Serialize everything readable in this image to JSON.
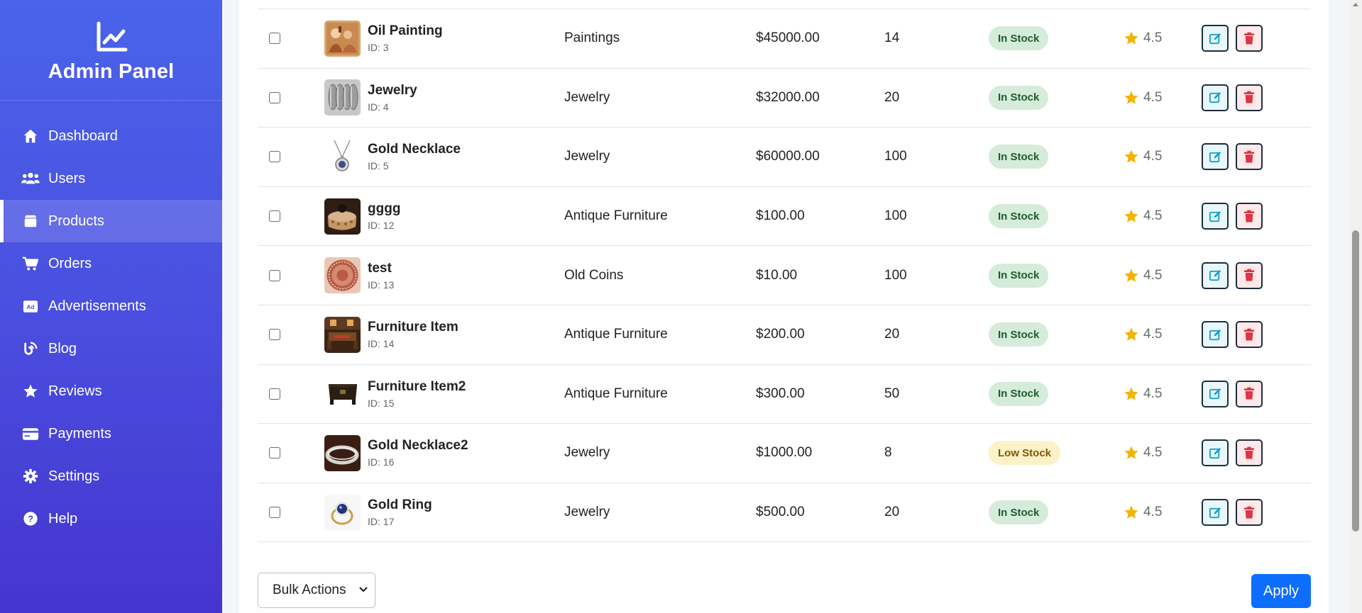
{
  "sidebar": {
    "title": "Admin Panel",
    "logo_icon": "chart-line-icon",
    "items": [
      {
        "label": "Dashboard",
        "icon": "home-icon",
        "active": false
      },
      {
        "label": "Users",
        "icon": "users-icon",
        "active": false
      },
      {
        "label": "Products",
        "icon": "box-icon",
        "active": true
      },
      {
        "label": "Orders",
        "icon": "cart-icon",
        "active": false
      },
      {
        "label": "Advertisements",
        "icon": "ad-icon",
        "active": false
      },
      {
        "label": "Blog",
        "icon": "blog-icon",
        "active": false
      },
      {
        "label": "Reviews",
        "icon": "star-icon",
        "active": false
      },
      {
        "label": "Payments",
        "icon": "credit-card-icon",
        "active": false
      },
      {
        "label": "Settings",
        "icon": "gear-icon",
        "active": false
      },
      {
        "label": "Help",
        "icon": "help-icon",
        "active": false
      }
    ]
  },
  "products": [
    {
      "name": "Oil Painting",
      "id": "ID: 3",
      "category": "Paintings",
      "price": "$45000.00",
      "qty": "14",
      "status": "In Stock",
      "status_type": "ok",
      "rating": "4.5",
      "thumb": "painting"
    },
    {
      "name": "Jewelry",
      "id": "ID: 4",
      "category": "Jewelry",
      "price": "$32000.00",
      "qty": "20",
      "status": "In Stock",
      "status_type": "ok",
      "rating": "4.5",
      "thumb": "rings"
    },
    {
      "name": "Gold Necklace",
      "id": "ID: 5",
      "category": "Jewelry",
      "price": "$60000.00",
      "qty": "100",
      "status": "In Stock",
      "status_type": "ok",
      "rating": "4.5",
      "thumb": "necklace"
    },
    {
      "name": "gggg",
      "id": "ID: 12",
      "category": "Antique Furniture",
      "price": "$100.00",
      "qty": "100",
      "status": "In Stock",
      "status_type": "ok",
      "rating": "4.5",
      "thumb": "box"
    },
    {
      "name": "test",
      "id": "ID: 13",
      "category": "Old Coins",
      "price": "$10.00",
      "qty": "100",
      "status": "In Stock",
      "status_type": "ok",
      "rating": "4.5",
      "thumb": "plate"
    },
    {
      "name": "Furniture Item",
      "id": "ID: 14",
      "category": "Antique Furniture",
      "price": "$200.00",
      "qty": "20",
      "status": "In Stock",
      "status_type": "ok",
      "rating": "4.5",
      "thumb": "room"
    },
    {
      "name": "Furniture Item2",
      "id": "ID: 15",
      "category": "Antique Furniture",
      "price": "$300.00",
      "qty": "50",
      "status": "In Stock",
      "status_type": "ok",
      "rating": "4.5",
      "thumb": "chest"
    },
    {
      "name": "Gold Necklace2",
      "id": "ID: 16",
      "category": "Jewelry",
      "price": "$1000.00",
      "qty": "8",
      "status": "Low Stock",
      "status_type": "low",
      "rating": "4.5",
      "thumb": "bracelet"
    },
    {
      "name": "Gold Ring",
      "id": "ID: 17",
      "category": "Jewelry",
      "price": "$500.00",
      "qty": "20",
      "status": "In Stock",
      "status_type": "ok",
      "rating": "4.5",
      "thumb": "ring"
    }
  ],
  "footer": {
    "bulk_label": "Bulk Actions",
    "apply_label": "Apply"
  },
  "colors": {
    "sidebar_top": "#4a63ea",
    "sidebar_bottom": "#4535cf",
    "in_stock_bg": "#d4ecd9",
    "low_stock_bg": "#fdf1c7",
    "star": "#f5b301",
    "apply": "#0d6efd",
    "edit": "#17a2c8",
    "delete": "#dc3545"
  }
}
